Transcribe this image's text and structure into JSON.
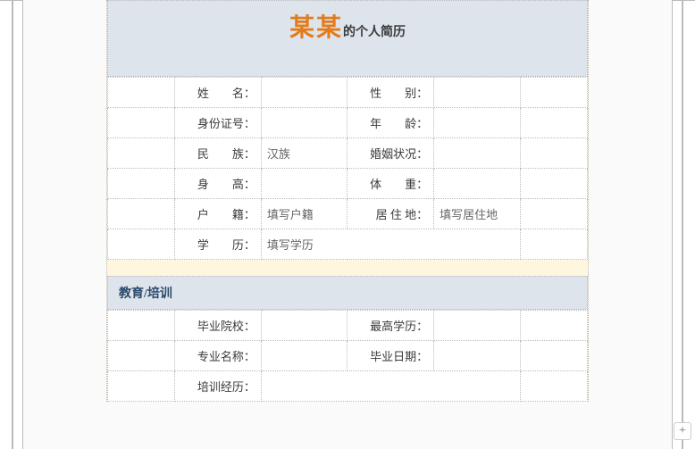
{
  "header": {
    "name": "某某",
    "suffix": "的个人简历"
  },
  "basic": {
    "rows": [
      {
        "l1": "姓　　名：",
        "v1": "",
        "l2": "性　　别：",
        "v2": ""
      },
      {
        "l1": "身份证号：",
        "v1": "",
        "l2": "年　　龄：",
        "v2": ""
      },
      {
        "l1": "民　　族：",
        "v1": "汉族",
        "l2": "婚姻状况：",
        "v2": ""
      },
      {
        "l1": "身　　高：",
        "v1": "",
        "l2": "体　　重：",
        "v2": ""
      },
      {
        "l1": "户　　籍：",
        "v1": "填写户籍",
        "l2": "居 住 地：",
        "v2": "填写居住地"
      },
      {
        "l1": "学　　历：",
        "v1": "填写学历",
        "l2": "",
        "v2": ""
      }
    ]
  },
  "edu": {
    "title": "教育/培训",
    "rows": [
      {
        "l1": "毕业院校：",
        "v1": "",
        "l2": "最高学历：",
        "v2": ""
      },
      {
        "l1": "专业名称：",
        "v1": "",
        "l2": "毕业日期：",
        "v2": ""
      },
      {
        "l1": "培训经历：",
        "v1": "",
        "l2": "",
        "v2": ""
      }
    ]
  },
  "ui": {
    "plus": "+"
  }
}
